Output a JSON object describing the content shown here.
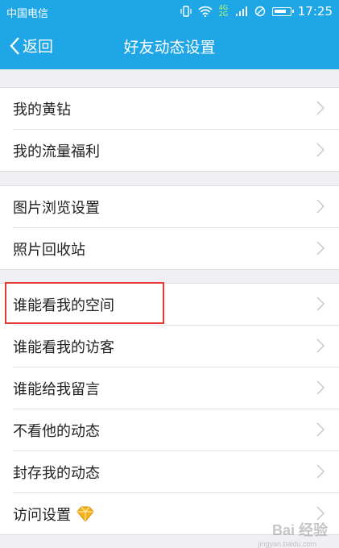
{
  "status_bar": {
    "carrier": "中国电信",
    "network": "4G 2G",
    "time": "17:25"
  },
  "nav": {
    "back_label": "返回",
    "title": "好友动态设置"
  },
  "groups": [
    {
      "items": [
        {
          "label": "我的黄钻"
        },
        {
          "label": "我的流量福利"
        }
      ]
    },
    {
      "items": [
        {
          "label": "图片浏览设置"
        },
        {
          "label": "照片回收站"
        }
      ]
    },
    {
      "items": [
        {
          "label": "谁能看我的空间"
        },
        {
          "label": "谁能看我的访客"
        },
        {
          "label": "谁能给我留言"
        },
        {
          "label": "不看他的动态"
        },
        {
          "label": "封存我的动态"
        },
        {
          "label": "访问设置",
          "icon": "diamond-icon"
        }
      ]
    }
  ],
  "colors": {
    "header": "#1fa6e6",
    "highlight": "#e53935",
    "diamond": "#f5b21b"
  },
  "watermark": "Bai 经验",
  "watermark_sub": "jingyan.baidu.com"
}
